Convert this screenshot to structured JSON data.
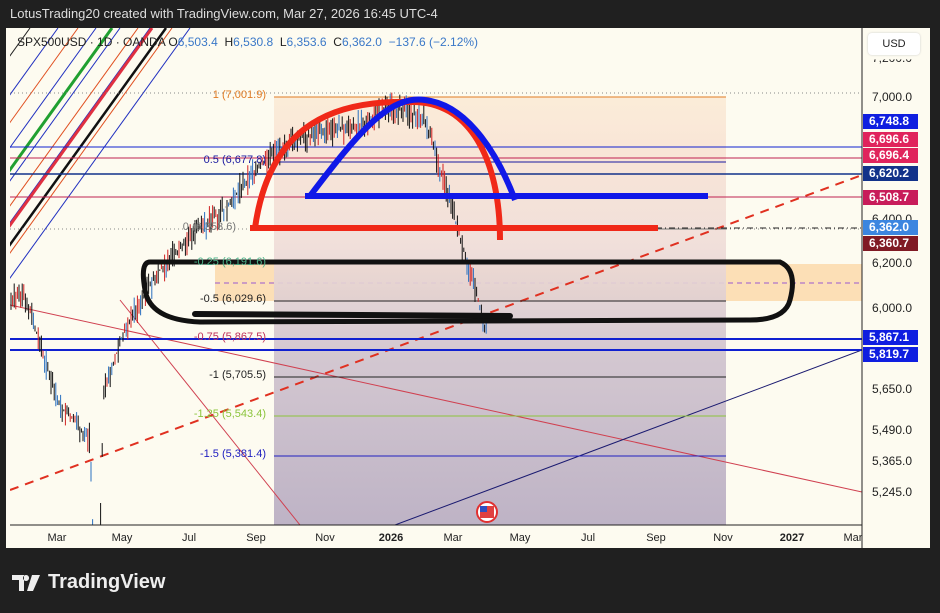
{
  "header": {
    "attribution": "LotusTrading20 created with TradingView.com, Mar 27, 2026 16:45 UTC-4"
  },
  "legend": {
    "symbol": "SPX500USD · 1D · OANDA",
    "o_label": "O",
    "open": "6,503.4",
    "h_label": "H",
    "high": "6,530.8",
    "l_label": "L",
    "low": "6,353.6",
    "c_label": "C",
    "close": "6,362.0",
    "change": "−137.6 (−2.12%)"
  },
  "currency": "USD",
  "price_axis": [
    "7,200.0",
    "7,000.0",
    "6,400.0",
    "6,200.0",
    "6,000.0",
    "5,650.0",
    "5,490.0",
    "5,365.0",
    "5,245.0"
  ],
  "price_badges": [
    {
      "text": "6,748.8",
      "color": "#0f1ee0"
    },
    {
      "text": "6,696.6",
      "color": "#e0245c"
    },
    {
      "text": "6,696.4",
      "color": "#e0245c"
    },
    {
      "text": "6,620.2",
      "color": "#12328a"
    },
    {
      "text": "6,508.7",
      "color": "#c81c5a"
    },
    {
      "text": "6,362.0",
      "color": "#3c86e0"
    },
    {
      "text": "6,360.7",
      "color": "#801a24"
    },
    {
      "text": "5,867.1",
      "color": "#0f1ee0"
    },
    {
      "text": "5,819.7",
      "color": "#0f1ee0"
    }
  ],
  "time_axis": [
    "Mar",
    "May",
    "Jul",
    "Sep",
    "Nov",
    "2026",
    "Mar",
    "May",
    "Jul",
    "Sep",
    "Nov",
    "2027",
    "Mar"
  ],
  "fib_levels": [
    {
      "label": "1 (7,001.9)",
      "color": "#e07b24"
    },
    {
      "label": "0.5 (6,677.8)",
      "color": "#1a1aa0"
    },
    {
      "label": "0 (6,353.6)",
      "color": "#777777"
    },
    {
      "label": "-0.25 (6,191.6)",
      "color": "#4db38a"
    },
    {
      "label": "-0.5 (6,029.6)",
      "color": "#222222"
    },
    {
      "label": "-0.75 (5,867.5)",
      "color": "#c0305a"
    },
    {
      "label": "-1 (5,705.5)",
      "color": "#222222"
    },
    {
      "label": "-1.25 (5,543.4)",
      "color": "#8cc43c"
    },
    {
      "label": "-1.5 (5,381.4)",
      "color": "#2020c0"
    }
  ],
  "chart_data": {
    "type": "candlestick",
    "symbol": "SPX500USD",
    "interval": "1D",
    "approx_monthly_close": [
      5950,
      6080,
      5600,
      5450,
      5900,
      6150,
      6320,
      6450,
      6650,
      6780,
      6820,
      6850,
      6950,
      6900,
      6362
    ],
    "months_from": "2025-01"
  },
  "brand": "TradingView"
}
